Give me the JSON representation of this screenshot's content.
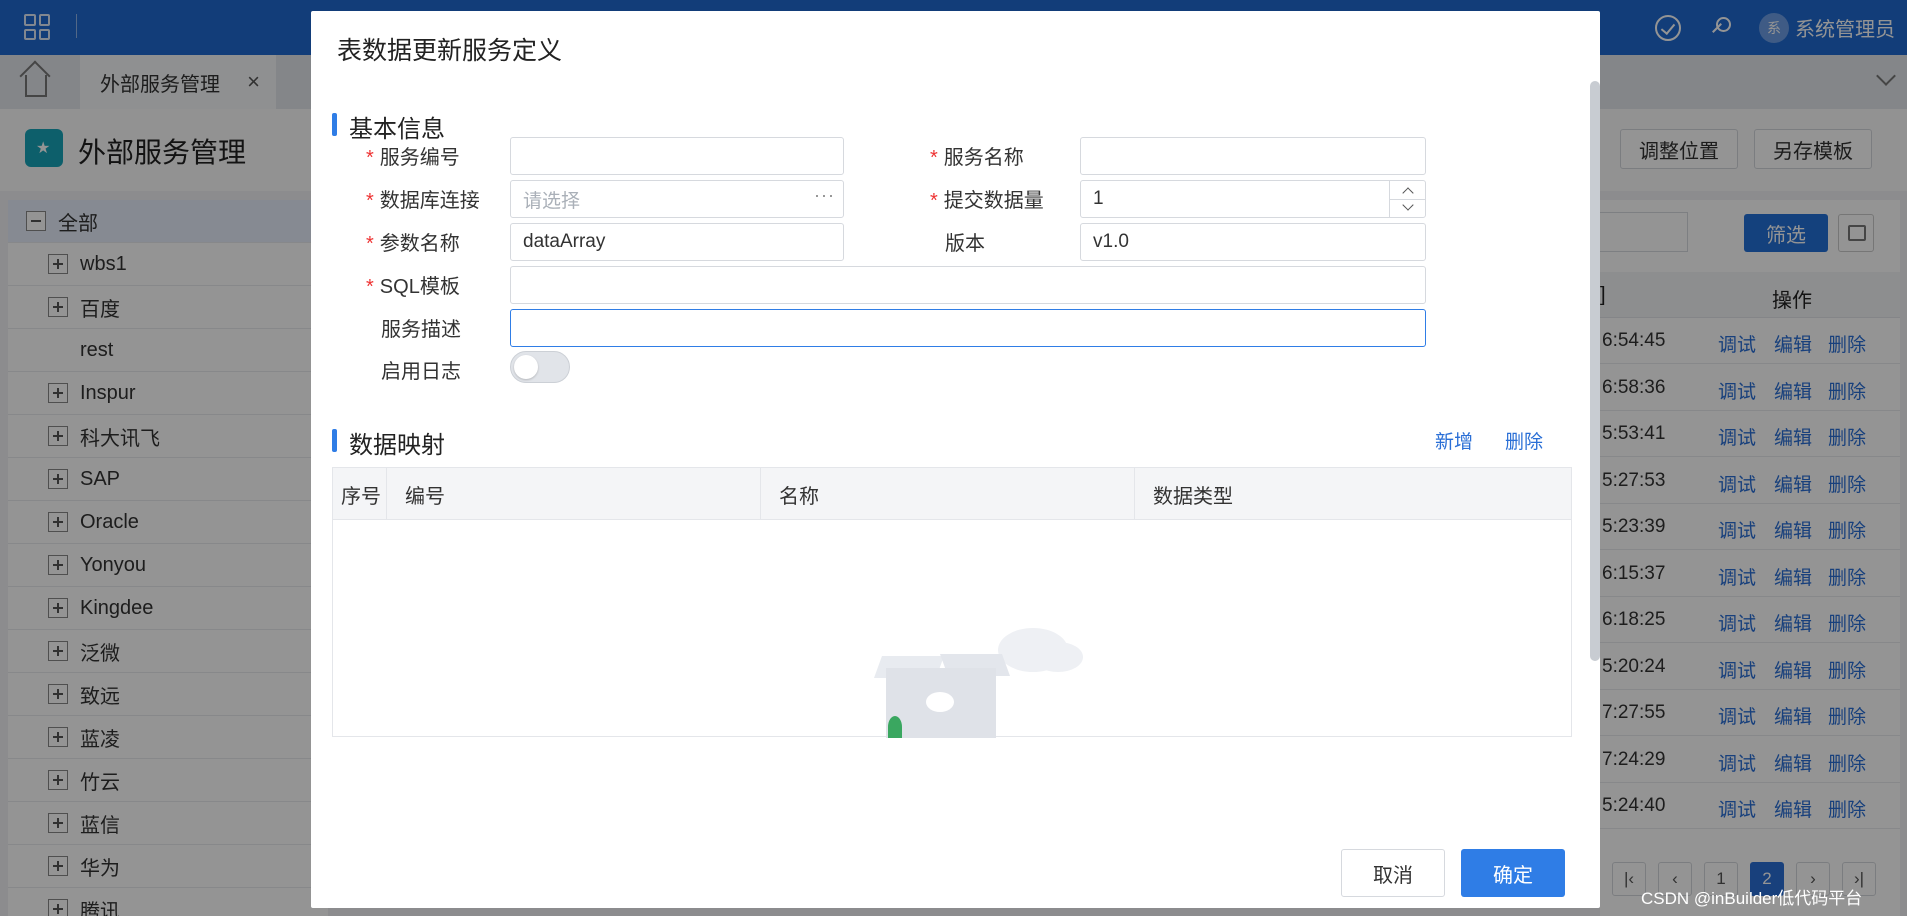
{
  "app": {
    "user_avatar_text": "系",
    "user_name": "系统管理员"
  },
  "tabs": {
    "active_label": "外部服务管理",
    "close_glyph": "×"
  },
  "header": {
    "title": "外部服务管理",
    "buttons": [
      "调整位置",
      "另存模板"
    ]
  },
  "tree": {
    "root": "全部",
    "items": [
      {
        "label": "wbs1",
        "expandable": true
      },
      {
        "label": "百度",
        "expandable": true
      },
      {
        "label": "rest",
        "expandable": false
      },
      {
        "label": "Inspur",
        "expandable": true
      },
      {
        "label": "科大讯飞",
        "expandable": true
      },
      {
        "label": "SAP",
        "expandable": true
      },
      {
        "label": "Oracle",
        "expandable": true
      },
      {
        "label": "Yonyou",
        "expandable": true
      },
      {
        "label": "Kingdee",
        "expandable": true
      },
      {
        "label": "泛微",
        "expandable": true
      },
      {
        "label": "致远",
        "expandable": true
      },
      {
        "label": "蓝凌",
        "expandable": true
      },
      {
        "label": "竹云",
        "expandable": true
      },
      {
        "label": "蓝信",
        "expandable": true
      },
      {
        "label": "华为",
        "expandable": true
      },
      {
        "label": "腾讯",
        "expandable": true
      }
    ]
  },
  "right_panel": {
    "filter_label": "筛选",
    "col_partial": "]",
    "col_ops": "操作",
    "actions": [
      "调试",
      "编辑",
      "删除"
    ],
    "times": [
      "6:54:45",
      "6:58:36",
      "5:53:41",
      "5:27:53",
      "5:23:39",
      "6:15:37",
      "6:18:25",
      "5:20:24",
      "7:27:55",
      "7:24:29",
      "5:24:40"
    ],
    "pager": [
      "1",
      "2"
    ]
  },
  "dialog": {
    "title": "表数据更新服务定义",
    "section_basic": "基本信息",
    "fields": {
      "service_code": {
        "label": "服务编号",
        "value": ""
      },
      "service_name": {
        "label": "服务名称",
        "value": ""
      },
      "db_conn": {
        "label": "数据库连接",
        "placeholder": "请选择"
      },
      "submit_count": {
        "label": "提交数据量",
        "value": "1"
      },
      "param_name": {
        "label": "参数名称",
        "value": "dataArray"
      },
      "version": {
        "label": "版本",
        "value": "v1.0"
      },
      "sql_template": {
        "label": "SQL模板",
        "value": ""
      },
      "service_desc": {
        "label": "服务描述",
        "value": ""
      },
      "enable_log": {
        "label": "启用日志",
        "enabled": false
      }
    },
    "required_mark": "*",
    "section_mapping": "数据映射",
    "mapping_add": "新增",
    "mapping_delete": "删除",
    "grid_columns": [
      "序号",
      "编号",
      "名称",
      "数据类型"
    ],
    "cancel": "取消",
    "ok": "确定"
  },
  "watermark": "CSDN @inBuilder低代码平台",
  "colors": {
    "brand": "#1f6ad1",
    "primary_button": "#2f7de6",
    "link": "#2a6fd6",
    "required": "#e33333"
  }
}
